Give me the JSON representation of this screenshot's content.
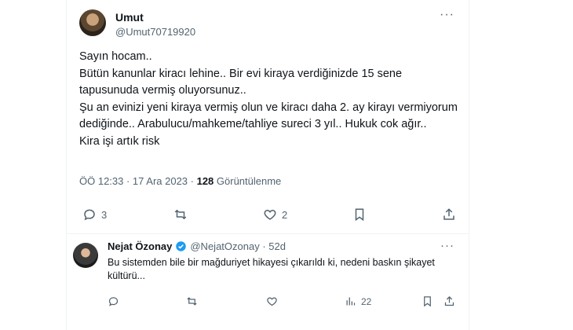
{
  "tweet": {
    "name": "Umut",
    "handle": "@Umut70719920",
    "more": "···",
    "text": "Sayın hocam..\nBütün kanunlar kiracı lehine.. Bir evi kiraya verdiğinizde 15 sene tapusunuda vermiş oluyorsunuz..\nŞu an evinizi yeni kiraya vermiş olun ve kiracı daha 2. ay kirayı vermiyorum dediğinde.. Arabulucu/mahkeme/tahliye sureci 3 yıl.. Hukuk cok ağır..\nKira işi artık risk",
    "timestamp": "ÖÖ 12:33 · 17 Ara 2023 · ",
    "views_count": "128",
    "views_label": " Görüntülenme",
    "actions": {
      "reply_count": "3",
      "retweet_count": "",
      "like_count": "2"
    }
  },
  "reply": {
    "name": "Nejat Özonay",
    "handle": "@NejatOzonay · 52d",
    "more": "···",
    "text": "Bu sistemden bile bir mağduriyet hikayesi çıkarıldı ki, nedeni baskın şikayet kültürü...",
    "actions": {
      "reply_count": "",
      "retweet_count": "",
      "like_count": "",
      "views_count": "22"
    }
  },
  "colors": {
    "text": "#0f1419",
    "secondary": "#536471",
    "verified": "#1d9bf0",
    "border": "#eff3f4"
  }
}
